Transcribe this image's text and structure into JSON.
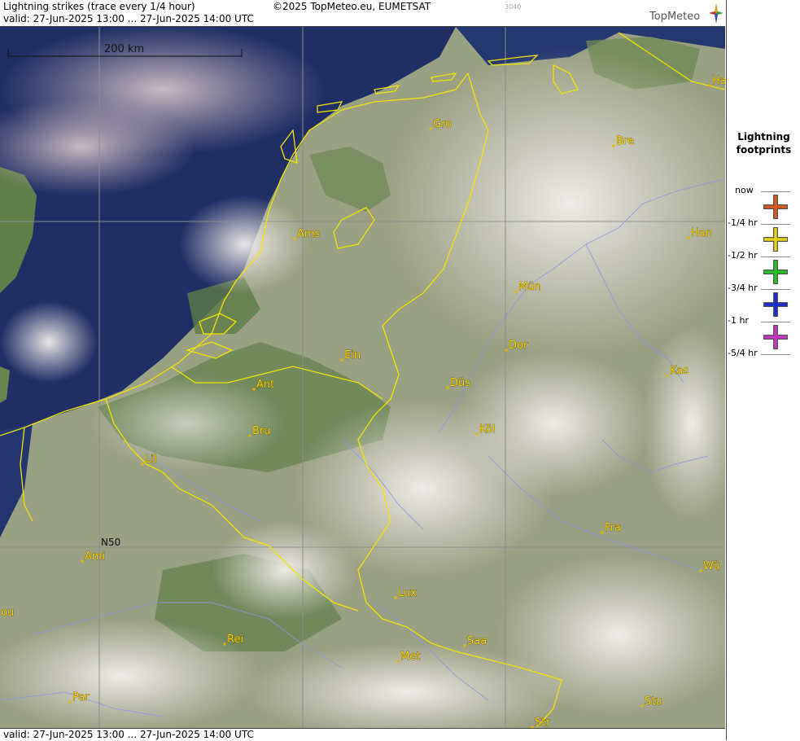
{
  "header": {
    "title": "Lightning strikes (trace every 1/4 hour)",
    "copyright": "©2025 TopMeteo.eu, EUMETSAT",
    "code": "3040",
    "valid": "valid:  27-Jun-2025 13:00 ... 27-Jun-2025 14:00 UTC",
    "brand": "TopMeteo"
  },
  "map": {
    "scale_label": "200 km",
    "lat_label": "N50",
    "cities": [
      {
        "name": "Gro"
      },
      {
        "name": "Bre"
      },
      {
        "name": "Ha"
      },
      {
        "name": "Ams"
      },
      {
        "name": "Han"
      },
      {
        "name": "Mün"
      },
      {
        "name": "Dor"
      },
      {
        "name": "Ein"
      },
      {
        "name": "Ant"
      },
      {
        "name": "Düs"
      },
      {
        "name": "Kas"
      },
      {
        "name": "Bru"
      },
      {
        "name": "Köl"
      },
      {
        "name": "Lil"
      },
      {
        "name": "Fra"
      },
      {
        "name": "Ami"
      },
      {
        "name": "Wü"
      },
      {
        "name": "Lux"
      },
      {
        "name": "ou"
      },
      {
        "name": "Rei"
      },
      {
        "name": "Saa"
      },
      {
        "name": "Met"
      },
      {
        "name": "Par"
      },
      {
        "name": "Stu"
      },
      {
        "name": "Str"
      }
    ]
  },
  "footer": {
    "valid": "valid:  27-Jun-2025 13:00 ... 27-Jun-2025 14:00 UTC"
  },
  "legend": {
    "title_line1": "Lightning",
    "title_line2": "footprints",
    "levels": [
      {
        "label": "now",
        "color": "#d9581e"
      },
      {
        "label": "-1/4 hr",
        "color": "#e6d21c"
      },
      {
        "label": "-1/2 hr",
        "color": "#27c323"
      },
      {
        "label": "-3/4 hr",
        "color": "#1b2bcf"
      },
      {
        "label": "-1 hr",
        "color": "#c733c4"
      },
      {
        "label": "-5/4 hr",
        "color": ""
      }
    ]
  }
}
